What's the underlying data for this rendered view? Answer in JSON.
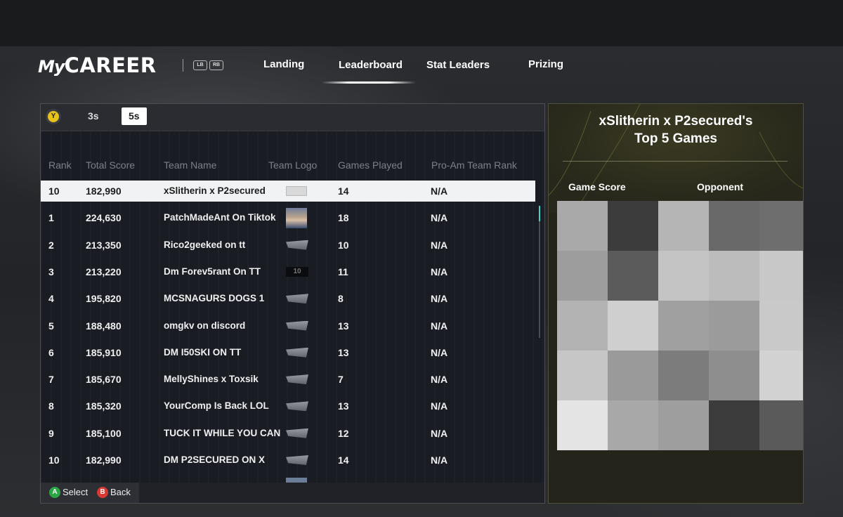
{
  "header": {
    "logo_my": "My",
    "logo_career": "CAREER",
    "bumpers": [
      "LB",
      "RB"
    ],
    "tabs": [
      {
        "label": "Landing",
        "active": false
      },
      {
        "label": "Leaderboard",
        "active": true
      },
      {
        "label": "Stat Leaders",
        "active": false
      },
      {
        "label": "Prizing",
        "active": false
      }
    ]
  },
  "mode": {
    "button_glyph": "Y",
    "tabs": [
      {
        "label": "3s",
        "active": false
      },
      {
        "label": "5s",
        "active": true
      }
    ]
  },
  "table": {
    "columns": [
      "Rank",
      "Total Score",
      "Team Name",
      "Team Logo",
      "Games Played",
      "Pro-Am Team Rank"
    ],
    "rows": [
      {
        "rank": "10",
        "score": "182,990",
        "team": "xSlitherin x P2secured",
        "logo": "hlogo",
        "games": "14",
        "proam": "N/A",
        "highlighted": true
      },
      {
        "rank": "1",
        "score": "224,630",
        "team": "PatchMadeAnt On Tiktok",
        "logo": "photo",
        "games": "18",
        "proam": "N/A"
      },
      {
        "rank": "2",
        "score": "213,350",
        "team": "Rico2geeked on tt",
        "logo": "badge",
        "games": "10",
        "proam": "N/A"
      },
      {
        "rank": "3",
        "score": "213,220",
        "team": "Dm Forev5rant On TT",
        "logo": "dark",
        "logo_text": "10",
        "games": "11",
        "proam": "N/A"
      },
      {
        "rank": "4",
        "score": "195,820",
        "team": "MCSNAGURS DOGS 1",
        "logo": "badge",
        "games": "8",
        "proam": "N/A"
      },
      {
        "rank": "5",
        "score": "188,480",
        "team": "omgkv on discord",
        "logo": "badge",
        "games": "13",
        "proam": "N/A"
      },
      {
        "rank": "6",
        "score": "185,910",
        "team": "DM I50SKI ON TT",
        "logo": "badge",
        "games": "13",
        "proam": "N/A"
      },
      {
        "rank": "7",
        "score": "185,670",
        "team": "MellyShines x Toxsik",
        "logo": "badge",
        "games": "7",
        "proam": "N/A"
      },
      {
        "rank": "8",
        "score": "185,320",
        "team": "YourComp Is Back LOL",
        "logo": "badge",
        "games": "13",
        "proam": "N/A"
      },
      {
        "rank": "9",
        "score": "185,100",
        "team": "TUCK IT WHILE YOU CAN",
        "logo": "badge",
        "games": "12",
        "proam": "N/A"
      },
      {
        "rank": "10",
        "score": "182,990",
        "team": "DM P2SECURED ON X",
        "logo": "badge",
        "games": "14",
        "proam": "N/A"
      },
      {
        "rank": "",
        "score": "",
        "team": "",
        "logo": "peek",
        "games": "",
        "proam": ""
      }
    ]
  },
  "footer": {
    "select_glyph": "A",
    "select_label": "Select",
    "back_glyph": "B",
    "back_label": "Back"
  },
  "right_panel": {
    "title_line1": "xSlitherin x P2secured's",
    "title_line2": "Top 5 Games",
    "col_game_score": "Game Score",
    "col_opponent": "Opponent",
    "mosaic_colors": [
      "#a9a9a9",
      "#3c3c3c",
      "#b5b5b5",
      "#696969",
      "#6e6e6e",
      "#9d9d9d",
      "#5b5b5b",
      "#c4c4c4",
      "#bcbcbc",
      "#c8c8c8",
      "#b3b3b3",
      "#cfcfcf",
      "#a0a0a0",
      "#9b9b9b",
      "#c9c9c9",
      "#c6c6c6",
      "#9a9a9a",
      "#7c7c7c",
      "#8e8e8e",
      "#d2d2d2",
      "#e4e4e4",
      "#a8a8a8",
      "#9e9e9e",
      "#3c3c3c",
      "#5a5a5a"
    ]
  }
}
